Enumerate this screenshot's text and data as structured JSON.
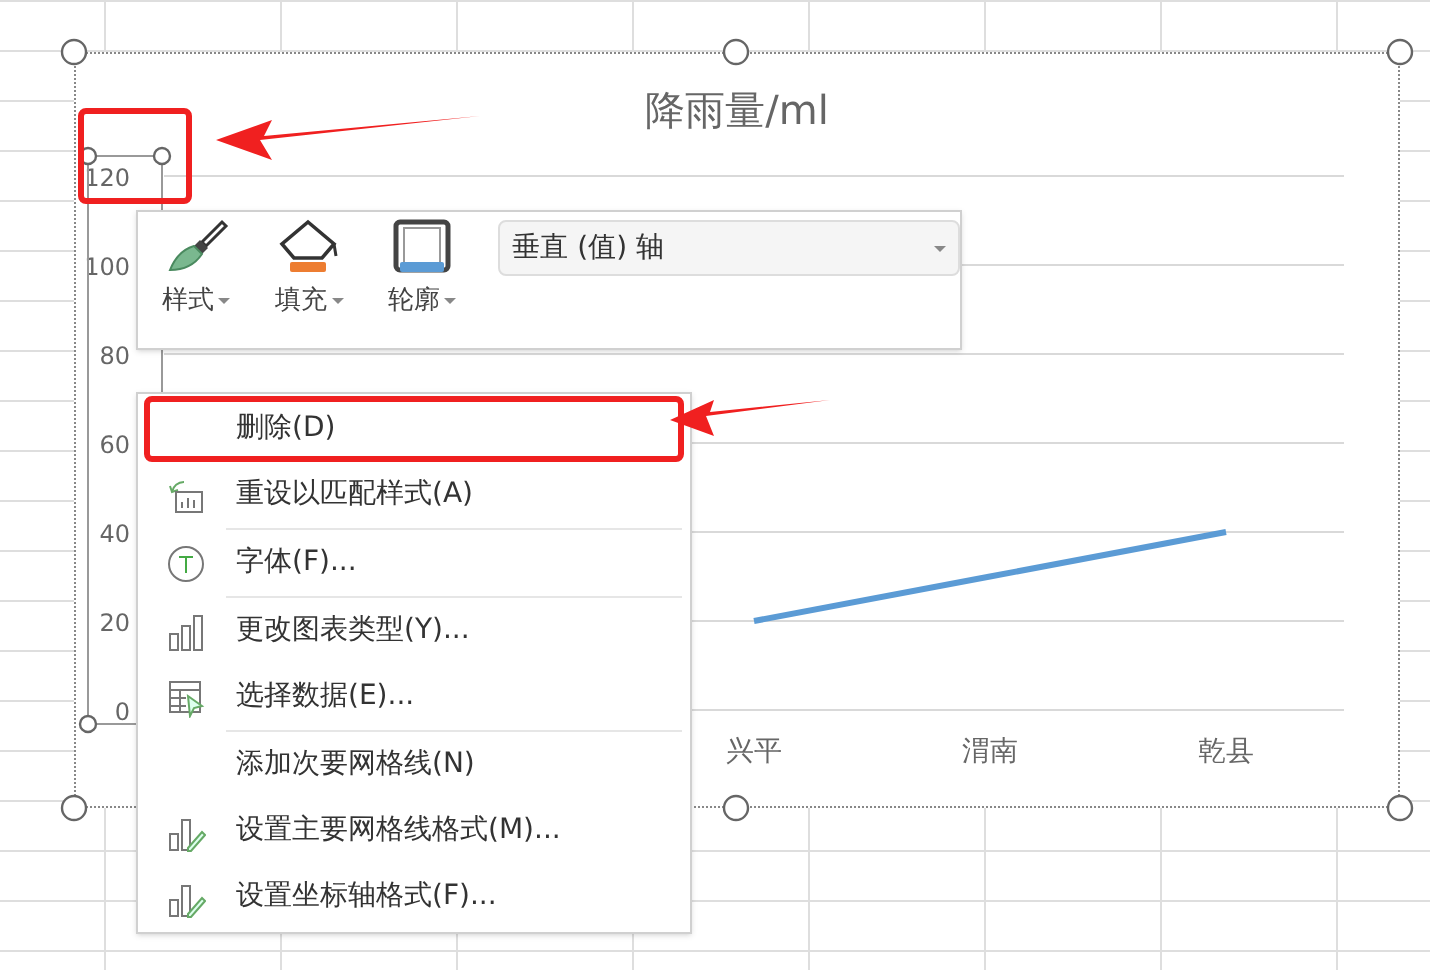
{
  "chart": {
    "title": "降雨量/ml",
    "selected": true,
    "chart_data": {
      "type": "line",
      "categories": [
        null,
        null,
        "兴平",
        "渭南",
        "乾县"
      ],
      "series": [
        {
          "color": "#5b9bd5",
          "values": [
            null,
            null,
            20,
            30,
            40
          ]
        }
      ],
      "ylim": [
        0,
        120
      ],
      "yticks": [
        0,
        20,
        40,
        60,
        80,
        100,
        120
      ],
      "grid": true
    },
    "y_axis": {
      "selected": true,
      "highlighted": true
    }
  },
  "mini_toolbar": {
    "buttons": [
      {
        "kind": "style",
        "label": "样式"
      },
      {
        "kind": "fill",
        "label": "填充"
      },
      {
        "kind": "outline",
        "label": "轮廓"
      }
    ],
    "element_select": {
      "value": "垂直 (值) 轴"
    }
  },
  "context_menu": {
    "items": [
      {
        "kind": "delete",
        "label": "删除(D)",
        "separator_before": false,
        "highlighted": true
      },
      {
        "kind": "reset",
        "label": "重设以匹配样式(A)",
        "separator_before": false,
        "highlighted": false
      },
      {
        "kind": "font",
        "label": "字体(F)...",
        "separator_before": true,
        "highlighted": false
      },
      {
        "kind": "chart-type",
        "label": "更改图表类型(Y)...",
        "separator_before": true,
        "highlighted": false
      },
      {
        "kind": "select-data",
        "label": "选择数据(E)...",
        "separator_before": false,
        "highlighted": false
      },
      {
        "kind": "gridlines",
        "label": "添加次要网格线(N)",
        "separator_before": true,
        "highlighted": false
      },
      {
        "kind": "gridline-format",
        "label": "设置主要网格线格式(M)...",
        "separator_before": false,
        "highlighted": false
      },
      {
        "kind": "axis-format",
        "label": "设置坐标轴格式(F)...",
        "separator_before": false,
        "highlighted": false
      }
    ]
  }
}
